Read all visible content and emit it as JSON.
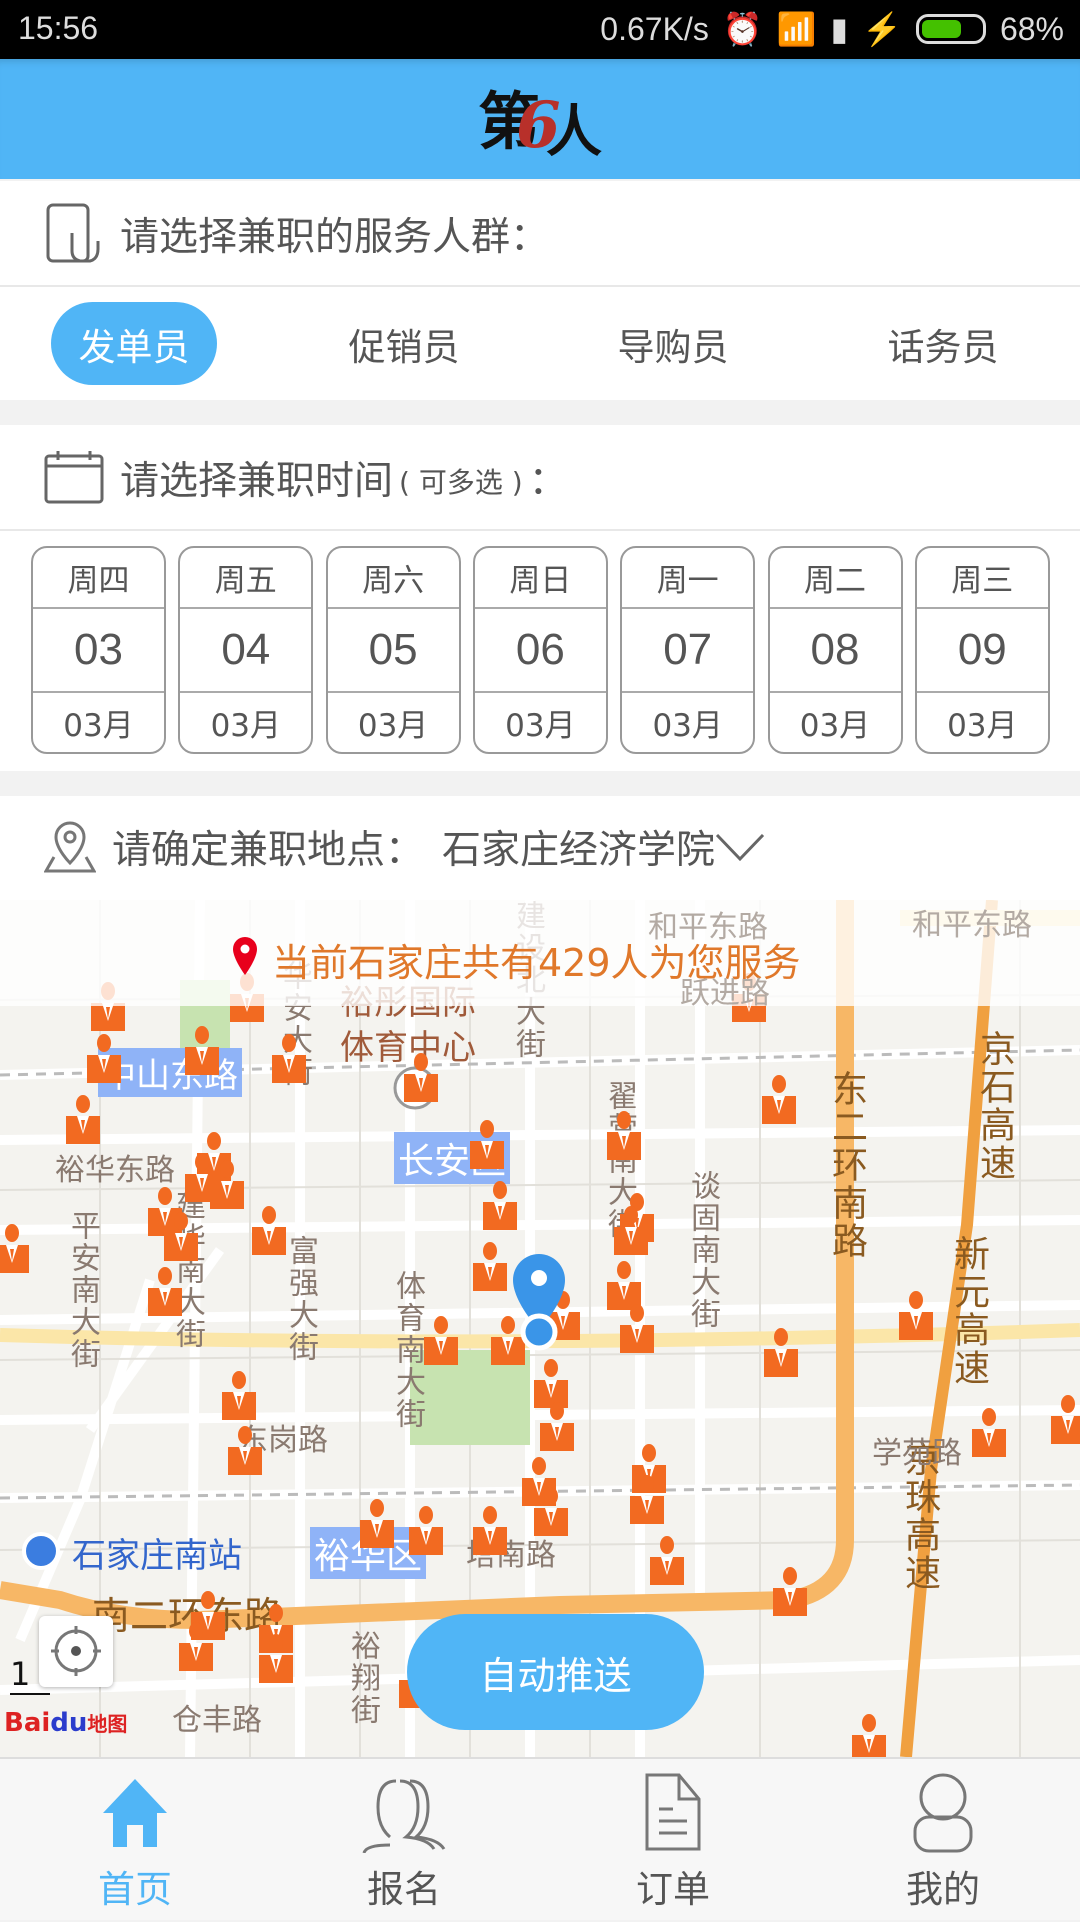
{
  "status_bar": {
    "time": "15:56",
    "net_speed": "0.67K/s",
    "battery": "68%",
    "battery_level": 0.68,
    "icons": [
      "alarm-icon",
      "wifi-icon",
      "signal-icon",
      "charging-icon",
      "battery-icon"
    ]
  },
  "header": {
    "logo_text": "第6人"
  },
  "service": {
    "title": "请选择兼职的服务人群：",
    "tabs": [
      {
        "label": "发单员",
        "active": true
      },
      {
        "label": "促销员"
      },
      {
        "label": "导购员"
      },
      {
        "label": "话务员"
      }
    ]
  },
  "time": {
    "title": "请选择兼职时间",
    "hint": "( 可多选 )",
    "colon": "：",
    "days": [
      {
        "weekday": "周四",
        "day": "03",
        "month": "03月"
      },
      {
        "weekday": "周五",
        "day": "04",
        "month": "03月"
      },
      {
        "weekday": "周六",
        "day": "05",
        "month": "03月"
      },
      {
        "weekday": "周日",
        "day": "06",
        "month": "03月"
      },
      {
        "weekday": "周一",
        "day": "07",
        "month": "03月"
      },
      {
        "weekday": "周二",
        "day": "08",
        "month": "03月"
      },
      {
        "weekday": "周三",
        "day": "09",
        "month": "03月"
      }
    ]
  },
  "location": {
    "label": "请确定兼职地点：",
    "value": "石家庄经济学院"
  },
  "map": {
    "banner": "当前石家庄共有429人为您服务",
    "labels": {
      "zhongshan": "中山东路",
      "changan": "长安区",
      "yuhua_district": "裕华区",
      "yutong1": "裕彤国际",
      "yutong2": "体育中心",
      "yuhua_east": "裕华东路",
      "donggang": "东岗路",
      "xueyuan": "学苑路",
      "tanan": "塔南路",
      "nanerhuan": "南二环东路",
      "cangfeng": "仓丰路",
      "south_station": "石家庄南站",
      "heping1": "和平东路",
      "heping2": "和平东路",
      "yuejin": "跃进路",
      "dongerhuan": "东二环南路",
      "jingshi": "京石高速",
      "xinyuan": "新元高速",
      "jingzhu": "京珠高速",
      "zhaiying": "翟营南大街",
      "tangu": "谈固南大街",
      "tiyu": "体育南大街",
      "fuqiang": "富强大街",
      "pingan": "平安南大街",
      "jianhua": "建华南大街",
      "yuxiang": "裕翔街",
      "huaan": "华安大街",
      "jianshe": "建设北大街",
      "zhongshan_x": "中山",
      "scale": "1"
    },
    "attribution": "Bai du 地图",
    "auto_push": "自动推送",
    "colors": {
      "ring_road": "#f7b766",
      "marker": "#f26a21",
      "pin": "#3a95e8"
    }
  },
  "nav": {
    "items": [
      {
        "label": "首页",
        "active": true,
        "icon": "home-icon"
      },
      {
        "label": "报名",
        "icon": "people-icon"
      },
      {
        "label": "订单",
        "icon": "document-icon"
      },
      {
        "label": "我的",
        "icon": "user-icon"
      }
    ],
    "active_color": "#50b5f6"
  }
}
